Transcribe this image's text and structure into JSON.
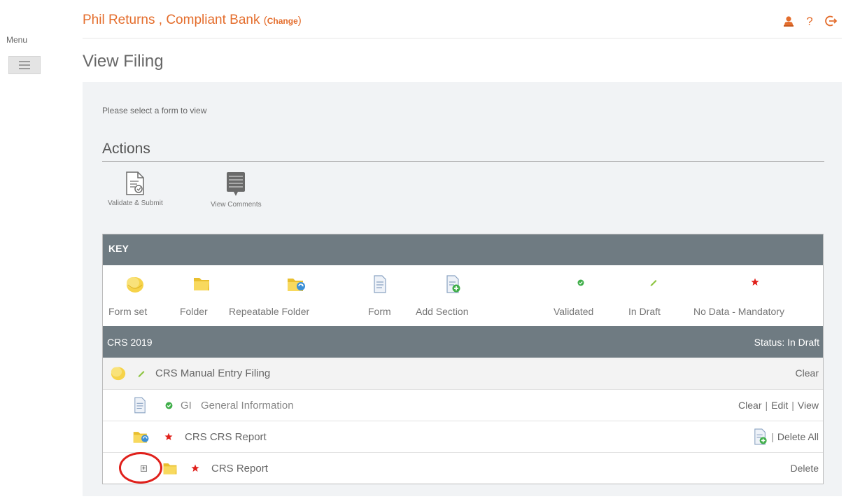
{
  "menu": {
    "label": "Menu"
  },
  "header": {
    "title": "Phil Returns , Compliant Bank",
    "change_label": "Change",
    "icons": [
      "user-icon",
      "help-icon",
      "logout-icon"
    ],
    "accent_color": "#e46d2c"
  },
  "page": {
    "title": "View Filing",
    "instructions": "Please select a form to view"
  },
  "actions": {
    "title": "Actions",
    "items": [
      {
        "label": "Validate & Submit",
        "icon": "validate-submit-icon"
      },
      {
        "label": "View Comments",
        "icon": "comments-icon"
      }
    ]
  },
  "key": {
    "title": "KEY",
    "items": [
      {
        "label": "Form set",
        "icon": "form-set-icon"
      },
      {
        "label": "Folder",
        "icon": "folder-icon"
      },
      {
        "label": "Repeatable Folder",
        "icon": "repeatable-folder-icon"
      },
      {
        "label": "Form",
        "icon": "form-icon"
      },
      {
        "label": "Add Section",
        "icon": "add-section-icon"
      },
      {
        "label": "Validated",
        "icon": "validated-icon"
      },
      {
        "label": "In Draft",
        "icon": "draft-pencil-icon"
      },
      {
        "label": "No Data - Mandatory",
        "icon": "mandatory-star-icon"
      }
    ]
  },
  "filing": {
    "name": "CRS 2019",
    "status": "Status: In Draft",
    "rows": [
      {
        "label": "CRS Manual Entry Filing",
        "actions": [
          "Clear"
        ]
      },
      {
        "code": "GI",
        "label": "General Information",
        "actions": [
          "Clear",
          "Edit",
          "View"
        ]
      },
      {
        "label": "CRS CRS Report",
        "actions": [
          "Delete All"
        ]
      },
      {
        "label": "CRS Report",
        "actions": [
          "Delete"
        ]
      }
    ]
  },
  "colors": {
    "bar": "#6f7b82",
    "validated": "#3fae49",
    "mandatory": "#e0201b",
    "highlight": "#e0201b"
  }
}
